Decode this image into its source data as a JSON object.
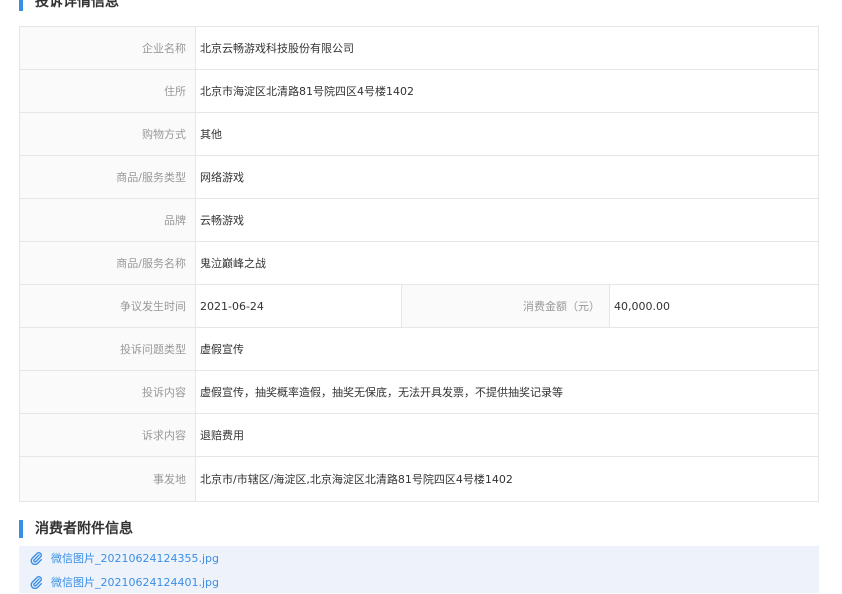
{
  "sections": {
    "complaint_title": "投诉详情信息",
    "attachments_title": "消费者附件信息"
  },
  "details": {
    "company": {
      "label": "企业名称",
      "value": "北京云畅游戏科技股份有限公司"
    },
    "address": {
      "label": "住所",
      "value": "北京市海淀区北清路81号院四区4号楼1402"
    },
    "purchase_method": {
      "label": "购物方式",
      "value": "其他"
    },
    "product_type": {
      "label": "商品/服务类型",
      "value": "网络游戏"
    },
    "brand": {
      "label": "品牌",
      "value": "云畅游戏"
    },
    "product_name": {
      "label": "商品/服务名称",
      "value": "鬼泣巅峰之战"
    },
    "dispute_date": {
      "label": "争议发生时间",
      "value": "2021-06-24"
    },
    "amount": {
      "label": "消费金额（元）",
      "value": "40,000.00"
    },
    "issue_type": {
      "label": "投诉问题类型",
      "value": "虚假宣传"
    },
    "content": {
      "label": "投诉内容",
      "value": "虚假宣传，抽奖概率造假，抽奖无保底，无法开具发票，不提供抽奖记录等"
    },
    "demand": {
      "label": "诉求内容",
      "value": "退赔费用"
    },
    "location": {
      "label": "事发地",
      "value": "北京市/市辖区/海淀区,北京海淀区北清路81号院四区4号楼1402"
    }
  },
  "attachments": [
    {
      "name": "微信图片_20210624124355.jpg",
      "icon": "paperclip-icon"
    },
    {
      "name": "微信图片_20210624124401.jpg",
      "icon": "paperclip-icon"
    }
  ],
  "colors": {
    "accent": "#3a8ee6",
    "label_text": "#999999",
    "border": "#e6e6e6",
    "attach_bg": "#eef3fb"
  }
}
